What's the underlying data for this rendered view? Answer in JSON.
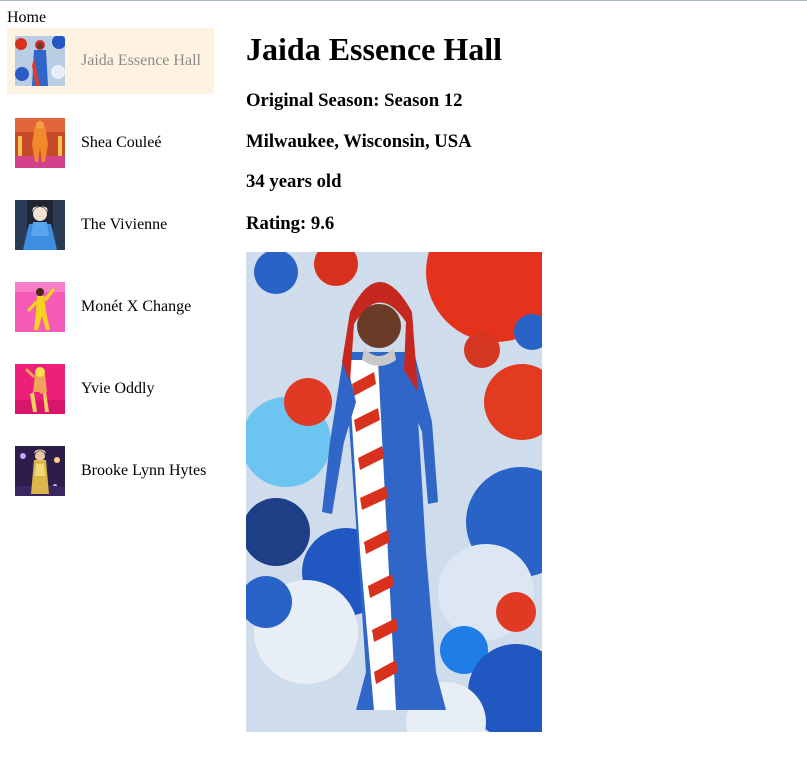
{
  "nav": {
    "home_label": "Home"
  },
  "sidebar": {
    "items": [
      {
        "label": "Jaida Essence Hall",
        "active": true
      },
      {
        "label": "Shea Couleé",
        "active": false
      },
      {
        "label": "The Vivienne",
        "active": false
      },
      {
        "label": "Monét X Change",
        "active": false
      },
      {
        "label": "Yvie Oddly",
        "active": false
      },
      {
        "label": "Brooke Lynn Hytes",
        "active": false
      }
    ]
  },
  "detail": {
    "name": "Jaida Essence Hall",
    "season": "Original Season: Season 12",
    "hometown": "Milwaukee, Wisconsin, USA",
    "age": "34 years old",
    "rating": "Rating: 9.6"
  },
  "colors": {
    "active_bg": "#fef2e1",
    "active_text": "#8c8c8c",
    "top_border": "#a9b8c9"
  }
}
